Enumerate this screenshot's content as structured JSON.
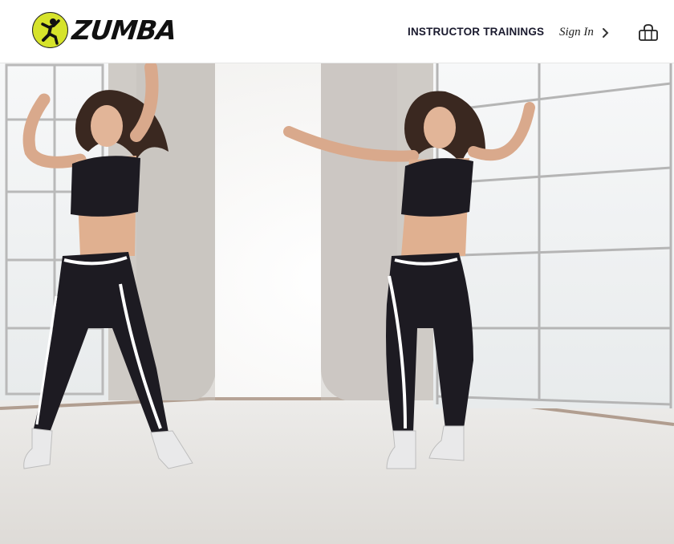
{
  "brand": {
    "logo_text": "ZUMBA",
    "logo_color": "#d6e32b"
  },
  "nav": {
    "trainings_label": "INSTRUCTOR TRAININGS",
    "signin_label": "Sign In",
    "signin_icon": "chevron-right-icon",
    "cart_icon": "shopping-bag-icon"
  },
  "hero": {
    "image_desc": "Two dancers in black crop tops and black leggings with white piping, dancing in a bright studio with garage-door windows",
    "accent_colors": {
      "outfit": "#1d1b22",
      "piping": "#ffffff",
      "wall": "#cfcbc6",
      "floor": "#ecebe9"
    }
  }
}
